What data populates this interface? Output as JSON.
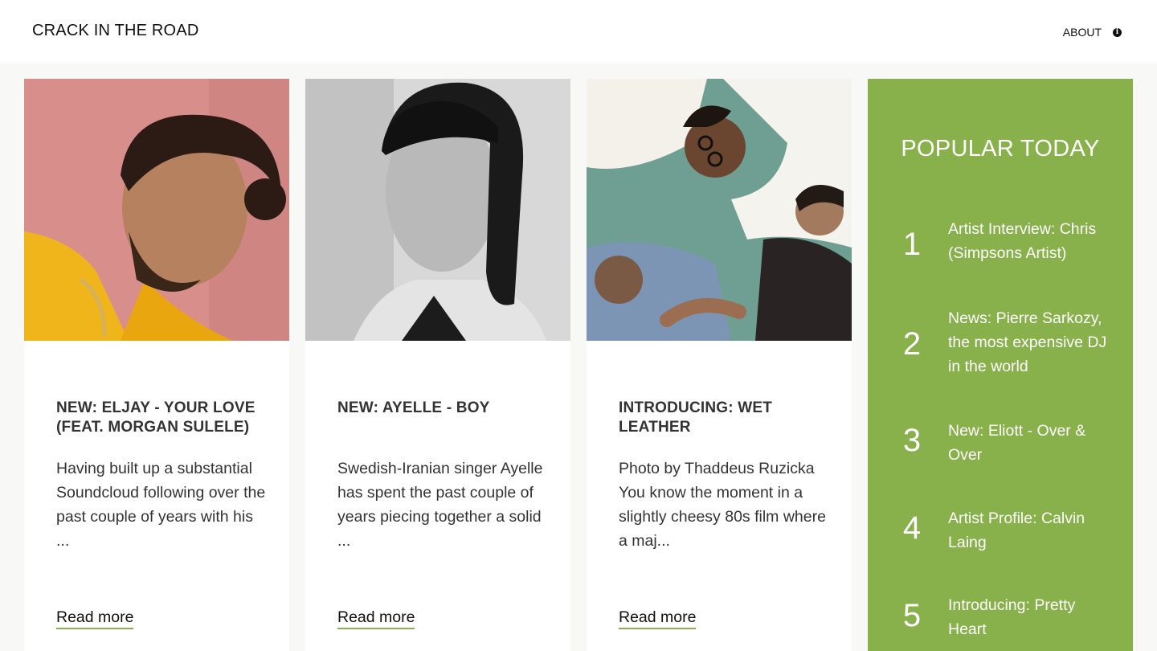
{
  "header": {
    "logo": "CRACK IN THE ROAD",
    "about_label": "ABOUT",
    "about_icon": "info-icon"
  },
  "colors": {
    "accent": "#88b04b",
    "background": "#f8f8f6",
    "card": "#ffffff",
    "text": "#333333"
  },
  "cards": [
    {
      "title": "NEW: ELJAY - YOUR LOVE (FEAT. MORGAN SULELE)",
      "excerpt": "Having built up a substantial Soundcloud following over the past couple of years with his ...",
      "read_more": "Read more"
    },
    {
      "title": "NEW: AYELLE - BOY",
      "excerpt": "Swedish-Iranian singer Ayelle has spent the past couple of years piecing together a solid ...",
      "read_more": "Read more"
    },
    {
      "title": "INTRODUCING: WET LEATHER",
      "excerpt": "Photo by Thaddeus Ruzicka You know the moment in a slightly cheesy 80s film where a maj...",
      "read_more": "Read more"
    }
  ],
  "popular": {
    "title": "POPULAR TODAY",
    "items": [
      {
        "rank": "1",
        "text": "Artist Interview: Chris (Simpsons Artist)"
      },
      {
        "rank": "2",
        "text": "News: Pierre Sarkozy, the most expensive DJ in the world"
      },
      {
        "rank": "3",
        "text": "New: Eliott - Over & Over"
      },
      {
        "rank": "4",
        "text": "Artist Profile: Calvin Laing"
      },
      {
        "rank": "5",
        "text": "Introducing: Pretty Heart"
      }
    ]
  }
}
